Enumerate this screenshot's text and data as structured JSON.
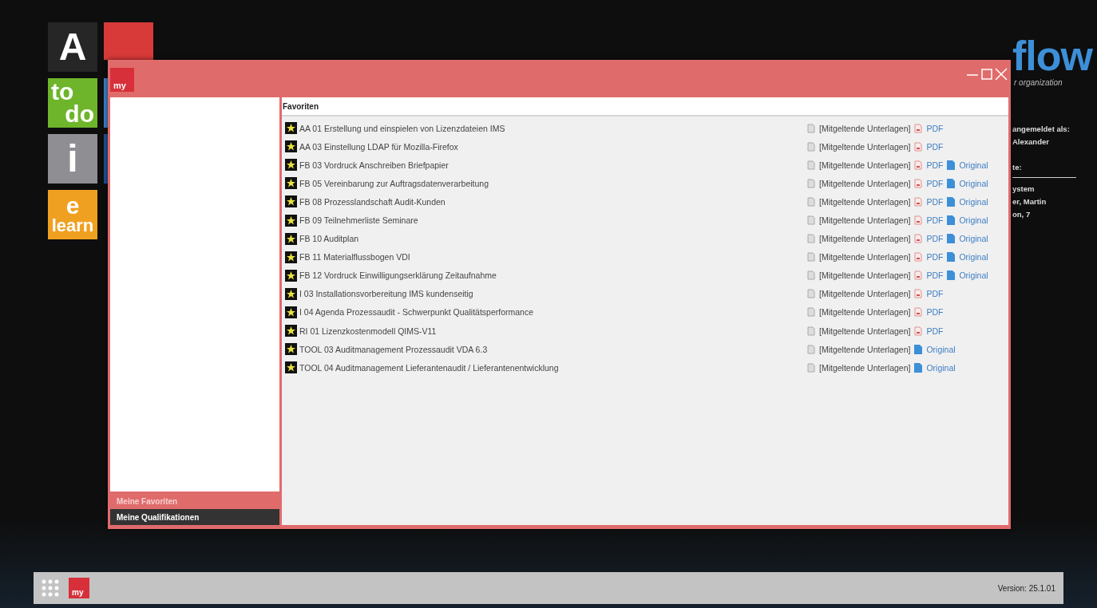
{
  "tiles": [
    {
      "kind": "letter",
      "text": "A",
      "color": "#262626"
    },
    {
      "kind": "two-line",
      "lines": [
        "to",
        "do"
      ],
      "color": "#6eb52b"
    },
    {
      "kind": "letter",
      "text": "i",
      "color": "#8e8e93"
    },
    {
      "kind": "two-line",
      "lines": [
        "e",
        "learn"
      ],
      "color": "#f0a020"
    }
  ],
  "hidden_tiles": [
    {
      "color": "#d83a3a"
    },
    {
      "color": "#3a7fc8"
    },
    {
      "color": "#1f4f8f"
    }
  ],
  "logo": {
    "text": "flow",
    "tagline": "r organization"
  },
  "user_info": {
    "lines": [
      "angemeldet als:",
      "Alexander"
    ],
    "section": "te:",
    "entries": [
      "ystem",
      "er, Martin",
      "on, 7"
    ]
  },
  "window": {
    "icon_text": "my",
    "nav": [
      {
        "label": "Meine Favoriten",
        "selected": true
      },
      {
        "label": "Meine Qualifikationen",
        "selected": false
      }
    ],
    "panel_title": "Favoriten",
    "rows": [
      {
        "title": "AA 01 Erstellung und einspielen von Lizenzdateien IMS",
        "attachments": "[Mitgeltende Unterlagen]",
        "pdf": "PDF"
      },
      {
        "title": "AA 03 Einstellung LDAP für Mozilla-Firefox",
        "attachments": "[Mitgeltende Unterlagen]",
        "pdf": "PDF"
      },
      {
        "title": "FB 03 Vordruck Anschreiben Briefpapier",
        "attachments": "[Mitgeltende Unterlagen]",
        "pdf": "PDF",
        "original": "Original"
      },
      {
        "title": "FB 05 Vereinbarung zur Auftragsdatenverarbeitung",
        "attachments": "[Mitgeltende Unterlagen]",
        "pdf": "PDF",
        "original": "Original"
      },
      {
        "title": "FB 08 Prozesslandschaft Audit-Kunden",
        "attachments": "[Mitgeltende Unterlagen]",
        "pdf": "PDF",
        "original": "Original"
      },
      {
        "title": "FB 09 Teilnehmerliste Seminare",
        "attachments": "[Mitgeltende Unterlagen]",
        "pdf": "PDF",
        "original": "Original"
      },
      {
        "title": "FB 10 Auditplan",
        "attachments": "[Mitgeltende Unterlagen]",
        "pdf": "PDF",
        "original": "Original"
      },
      {
        "title": "FB 11 Materialflussbogen VDI",
        "attachments": "[Mitgeltende Unterlagen]",
        "pdf": "PDF",
        "original": "Original"
      },
      {
        "title": "FB 12 Vordruck Einwilligungserklärung Zeitaufnahme",
        "attachments": "[Mitgeltende Unterlagen]",
        "pdf": "PDF",
        "original": "Original"
      },
      {
        "title": "I 03 Installationsvorbereitung IMS kundenseitig",
        "attachments": "[Mitgeltende Unterlagen]",
        "pdf": "PDF"
      },
      {
        "title": "I 04 Agenda Prozessaudit - Schwerpunkt Qualitätsperformance",
        "attachments": "[Mitgeltende Unterlagen]",
        "pdf": "PDF"
      },
      {
        "title": "RI 01 Lizenzkostenmodell QIMS-V11",
        "attachments": "[Mitgeltende Unterlagen]",
        "pdf": "PDF"
      },
      {
        "title": "TOOL 03 Auditmanagement Prozessaudit VDA 6.3",
        "attachments": "[Mitgeltende Unterlagen]",
        "original": "Original"
      },
      {
        "title": "TOOL 04 Auditmanagement Lieferantenaudit / Lieferantenentwicklung",
        "attachments": "[Mitgeltende Unterlagen]",
        "original": "Original"
      }
    ]
  },
  "taskbar": {
    "icon_text": "my",
    "version": "Version: 25.1.01"
  }
}
